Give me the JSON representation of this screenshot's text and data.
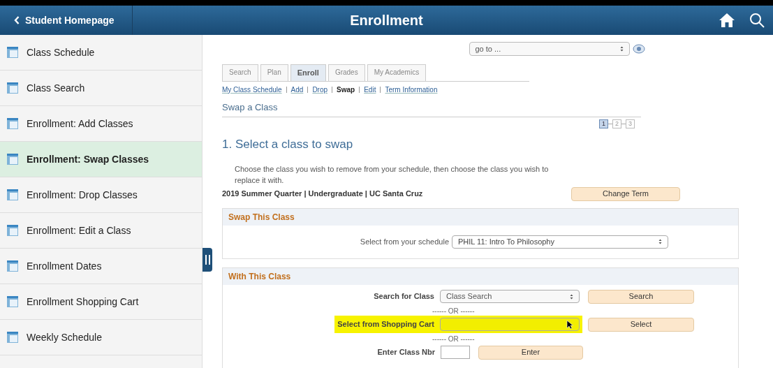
{
  "header": {
    "back": "Student Homepage",
    "title": "Enrollment"
  },
  "sidebar": {
    "items": [
      {
        "label": "Class Schedule",
        "selected": false
      },
      {
        "label": "Class Search",
        "selected": false
      },
      {
        "label": "Enrollment:  Add Classes",
        "selected": false
      },
      {
        "label": "Enrollment:  Swap Classes",
        "selected": true
      },
      {
        "label": "Enrollment:  Drop Classes",
        "selected": false
      },
      {
        "label": "Enrollment:  Edit a Class",
        "selected": false
      },
      {
        "label": "Enrollment Dates",
        "selected": false
      },
      {
        "label": "Enrollment Shopping Cart",
        "selected": false
      },
      {
        "label": "Weekly Schedule",
        "selected": false
      }
    ]
  },
  "goto": {
    "value": "go to ..."
  },
  "tabs": [
    {
      "label": "Search",
      "selected": false
    },
    {
      "label": "Plan",
      "selected": false
    },
    {
      "label": "Enroll",
      "selected": true
    },
    {
      "label": "Grades",
      "selected": false
    },
    {
      "label": "My Academics",
      "selected": false
    }
  ],
  "sublinks": [
    {
      "label": "My Class Schedule",
      "selected": false
    },
    {
      "label": "Add",
      "selected": false
    },
    {
      "label": "Drop",
      "selected": false
    },
    {
      "label": "Swap",
      "selected": true
    },
    {
      "label": "Edit",
      "selected": false
    },
    {
      "label": "Term Information",
      "selected": false
    }
  ],
  "page_title": "Swap a Class",
  "steps": [
    {
      "label": "1",
      "selected": true
    },
    {
      "label": "2",
      "selected": false
    },
    {
      "label": "3",
      "selected": false
    }
  ],
  "heading": "1.  Select a class to swap",
  "description": "Choose the class you wish to remove from your schedule, then choose the class you wish to replace it with.",
  "term": "2019 Summer Quarter | Undergraduate | UC Santa Cruz",
  "change_term_button": "Change Term",
  "swap_panel": {
    "title": "Swap This Class",
    "label": "Select from your schedule",
    "value": "PHIL 11: Intro To Philosophy"
  },
  "with_panel": {
    "title": "With This Class",
    "rows": [
      {
        "kind": "select",
        "label": "Search for Class",
        "value": "Class Search",
        "button": "Search",
        "highlighted": false
      },
      {
        "kind": "separator",
        "label": "------ OR ------"
      },
      {
        "kind": "select",
        "label": "Select from Shopping Cart",
        "button": "Select",
        "highlighted": true
      },
      {
        "kind": "separator",
        "label": "------ OR ------"
      },
      {
        "kind": "input",
        "label": "Enter Class Nbr",
        "button": "Enter",
        "highlighted": false
      }
    ]
  }
}
